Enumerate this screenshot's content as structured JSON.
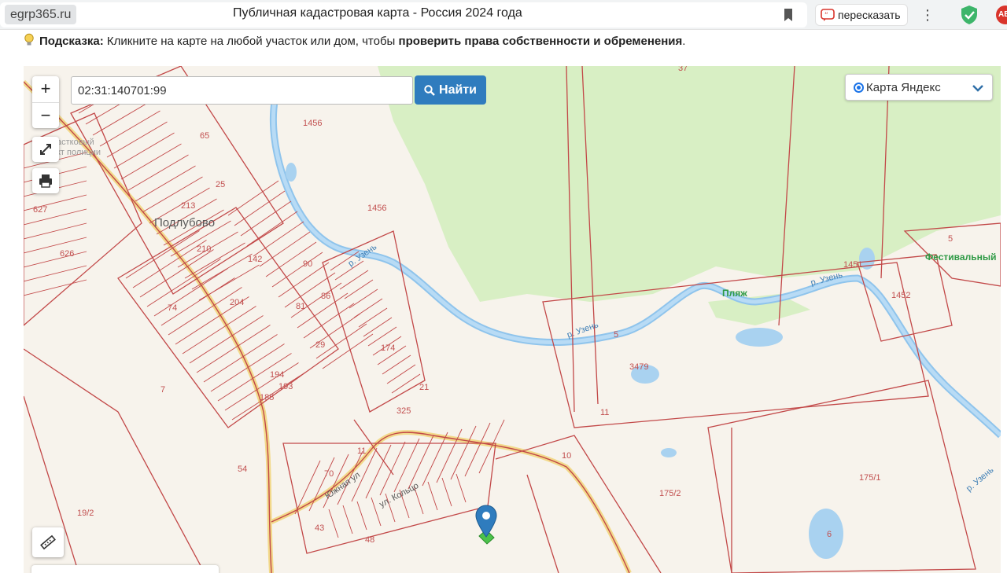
{
  "browser": {
    "domain": "egrp365.ru",
    "title": "Публичная кадастровая карта - Россия 2024 года",
    "retell_label": "пересказать",
    "abp_text": "AB",
    "icons": [
      "bookmark-icon",
      "retell-icon",
      "more-vert-icon",
      "shield-icon",
      "adblock-icon"
    ]
  },
  "hint": {
    "label": "Подсказка:",
    "text": "Кликните на карте на любой участок или дом, чтобы",
    "emphasis": "проверить права собственности и обременения",
    "end": "."
  },
  "map": {
    "search": {
      "value": "02:31:140701:99"
    },
    "find_button": "Найти",
    "layer": "Карта Яндекс",
    "zoom_in": "+",
    "zoom_out": "−",
    "place_name": "Подлубово",
    "pois": [
      "Пляж",
      "Фестивальный"
    ],
    "faded_poi": [
      "астковый",
      "кт полиции"
    ],
    "river_labels": [
      "р. Узень",
      "р. Узень",
      "р. Узень",
      "р. Узень"
    ],
    "street_labels": [
      "Южная ул",
      "ул. Кольцо"
    ],
    "parcel_labels": [
      "37",
      "1456",
      "1456",
      "65",
      "25",
      "213",
      "627",
      "626",
      "210",
      "142",
      "90",
      "74",
      "204",
      "81",
      "86",
      "29",
      "174",
      "194",
      "193",
      "185",
      "21",
      "325",
      "54",
      "70",
      "11",
      "43",
      "48",
      "19/2",
      "175/2",
      "175/1",
      "6",
      "1452",
      "1451",
      "5",
      "3479",
      "11",
      "10",
      "7",
      "5"
    ],
    "colors": {
      "parcel": "#c24848",
      "forest": "#d8efc4",
      "water": "#b3d6f2",
      "road": "#f2d98a",
      "marker": "#2f7cbe"
    }
  }
}
